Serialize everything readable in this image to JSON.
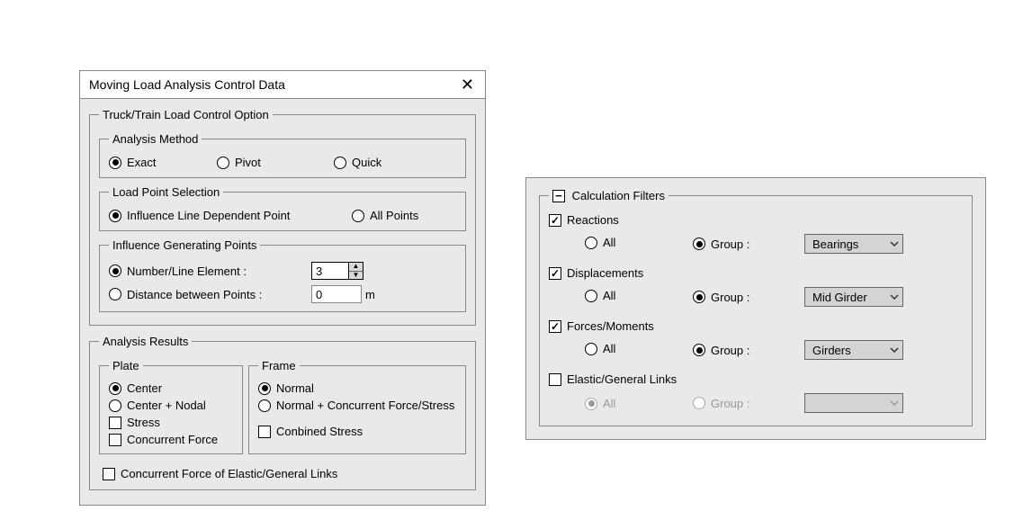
{
  "dialog": {
    "title": "Moving Load Analysis Control Data",
    "truck_train": {
      "legend": "Truck/Train Load Control Option",
      "analysis_method": {
        "legend": "Analysis Method",
        "options": {
          "exact": "Exact",
          "pivot": "Pivot",
          "quick": "Quick"
        },
        "selected": "exact"
      },
      "load_point_selection": {
        "legend": "Load Point Selection",
        "options": {
          "ildp": "Influence Line Dependent Point",
          "all": "All Points"
        },
        "selected": "ildp"
      },
      "influence_generating_points": {
        "legend": "Influence Generating Points",
        "number_label": "Number/Line Element :",
        "number_value": "3",
        "distance_label": "Distance between Points :",
        "distance_value": "0",
        "distance_unit": "m",
        "selected": "number"
      }
    },
    "analysis_results": {
      "legend": "Analysis Results",
      "plate": {
        "legend": "Plate",
        "center": "Center",
        "center_nodal": "Center + Nodal",
        "stress": "Stress",
        "concurrent_force": "Concurrent Force",
        "radio_selected": "center",
        "stress_checked": false,
        "concurrent_force_checked": false
      },
      "frame": {
        "legend": "Frame",
        "normal": "Normal",
        "normal_concurrent": "Normal + Concurrent Force/Stress",
        "combined_stress": "Conbined Stress",
        "radio_selected": "normal",
        "combined_stress_checked": false
      },
      "concurrent_links": {
        "label": "Concurrent Force of Elastic/General Links",
        "checked": false
      }
    }
  },
  "calc_filters": {
    "legend": "Calculation Filters",
    "expanded": false,
    "sections": {
      "reactions": {
        "label": "Reactions",
        "checked": true,
        "all_label": "All",
        "group_label": "Group :",
        "selected": "group",
        "dropdown": "Bearings"
      },
      "displacements": {
        "label": "Displacements",
        "checked": true,
        "all_label": "All",
        "group_label": "Group :",
        "selected": "group",
        "dropdown": "Mid Girder"
      },
      "forces": {
        "label": "Forces/Moments",
        "checked": true,
        "all_label": "All",
        "group_label": "Group :",
        "selected": "group",
        "dropdown": "Girders"
      },
      "elastic_links": {
        "label": "Elastic/General Links",
        "checked": false,
        "all_label": "All",
        "group_label": "Group :",
        "selected": "all",
        "dropdown": ""
      }
    }
  }
}
